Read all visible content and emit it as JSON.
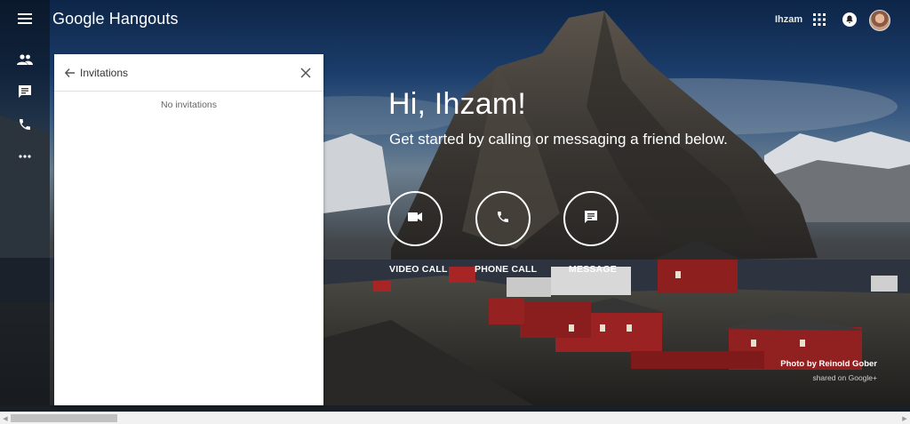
{
  "app": {
    "name": "Google Hangouts"
  },
  "topbar": {
    "username": "Ihzam"
  },
  "rail": {
    "items": [
      {
        "icon": "menu-icon"
      },
      {
        "icon": "contacts-icon"
      },
      {
        "icon": "chat-icon"
      },
      {
        "icon": "phone-icon"
      },
      {
        "icon": "more-icon"
      }
    ]
  },
  "panel": {
    "title": "Invitations",
    "empty_text": "No invitations"
  },
  "hero": {
    "greeting": "Hi, Ihzam!",
    "subline": "Get started by calling or messaging a friend below.",
    "actions": [
      {
        "label": "VIDEO CALL",
        "icon": "videocam-icon"
      },
      {
        "label": "PHONE CALL",
        "icon": "phone-icon"
      },
      {
        "label": "MESSAGE",
        "icon": "message-icon"
      }
    ]
  },
  "credit": {
    "line1": "Photo by Reinold Gober",
    "line2": "shared on Google+"
  },
  "colors": {
    "panel_bg": "#ffffff",
    "text_light": "#ffffff"
  }
}
